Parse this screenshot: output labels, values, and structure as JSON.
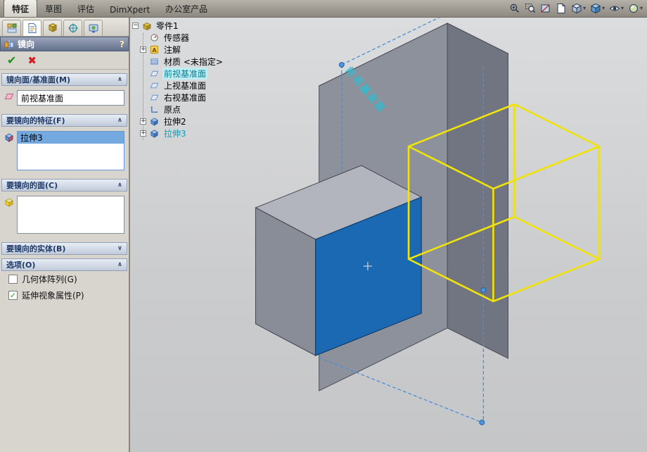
{
  "command_tabs": {
    "items": [
      {
        "label": "特征",
        "active": true
      },
      {
        "label": "草图",
        "active": false
      },
      {
        "label": "评估",
        "active": false
      },
      {
        "label": "DimXpert",
        "active": false
      },
      {
        "label": "办公室产品",
        "active": false
      }
    ]
  },
  "view_toolbar": {
    "icons": [
      "zoom-in",
      "zoom-to-area",
      "section-view",
      "sheet",
      "view-orientation",
      "display-style",
      "hide-show-items",
      "appearance"
    ],
    "dropdown_glyph": "▾"
  },
  "property_manager": {
    "title": "镜向",
    "help_icon": "?",
    "ok_icon": "✔",
    "cancel_icon": "✖",
    "check_glyph": "✓",
    "chevron_expanded": "∧",
    "chevron_collapsed": "∨",
    "groups": {
      "mirror_plane": {
        "title": "镜向面/基准面(M)",
        "field_value": "前视基准面"
      },
      "features": {
        "title": "要镜向的特征(F)",
        "items": [
          {
            "label": "拉伸3",
            "selected": true
          }
        ]
      },
      "faces": {
        "title": "要镜向的面(C)"
      },
      "bodies": {
        "title": "要镜向的实体(B)",
        "collapsed": true
      },
      "options": {
        "title": "选项(O)",
        "checkboxes": [
          {
            "label": "几何体阵列(G)",
            "checked": false
          },
          {
            "label": "延伸视象属性(P)",
            "checked": true
          }
        ]
      }
    }
  },
  "feature_tree": {
    "root": {
      "label": "零件1"
    },
    "plus_glyph": "+",
    "minus_glyph": "−",
    "annotation_letter": "A",
    "items": [
      {
        "label": "传感器",
        "icon": "sensors-icon"
      },
      {
        "label": "注解",
        "icon": "annotations-icon",
        "expandable": true
      },
      {
        "label": "材质 <未指定>",
        "icon": "material-icon"
      },
      {
        "label": "前视基准面",
        "icon": "plane-icon",
        "selected": true
      },
      {
        "label": "上视基准面",
        "icon": "plane-icon"
      },
      {
        "label": "右视基准面",
        "icon": "plane-icon"
      },
      {
        "label": "原点",
        "icon": "origin-icon"
      },
      {
        "label": "拉伸2",
        "icon": "extrude-icon",
        "expandable": true
      },
      {
        "label": "拉伸3",
        "icon": "extrude-icon",
        "expandable": true,
        "selected": true
      }
    ]
  },
  "viewport": {
    "plane_label": "前视基准面",
    "colors": {
      "selected_face": "#1a69b2",
      "preview_wireframe": "#f0e20a",
      "plane_label_teal": "#2fbdd2",
      "body_gray": "#8d919c"
    }
  }
}
